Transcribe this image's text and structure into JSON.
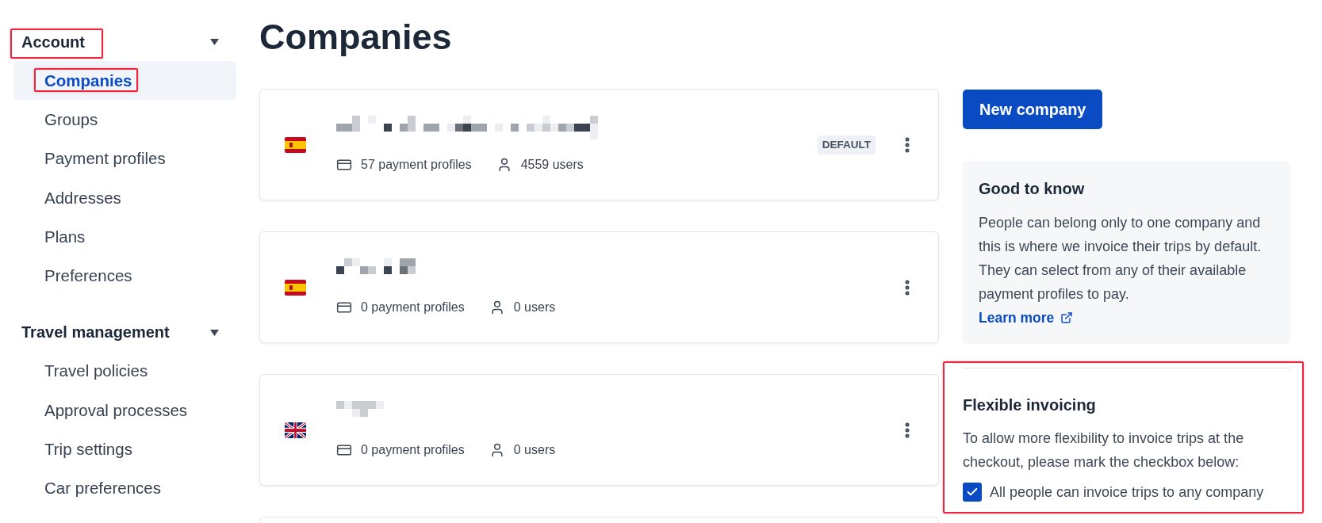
{
  "sidebar": {
    "groups": [
      {
        "title": "Account",
        "expanded": true,
        "highlighted": true,
        "items": [
          {
            "label": "Companies",
            "selected": true,
            "highlighted": true
          },
          {
            "label": "Groups",
            "selected": false,
            "highlighted": false
          },
          {
            "label": "Payment profiles",
            "selected": false,
            "highlighted": false
          },
          {
            "label": "Addresses",
            "selected": false,
            "highlighted": false
          },
          {
            "label": "Plans",
            "selected": false,
            "highlighted": false
          },
          {
            "label": "Preferences",
            "selected": false,
            "highlighted": false
          }
        ]
      },
      {
        "title": "Travel management",
        "expanded": true,
        "highlighted": false,
        "items": [
          {
            "label": "Travel policies",
            "selected": false,
            "highlighted": false
          },
          {
            "label": "Approval processes",
            "selected": false,
            "highlighted": false
          },
          {
            "label": "Trip settings",
            "selected": false,
            "highlighted": false
          },
          {
            "label": "Car preferences",
            "selected": false,
            "highlighted": false
          }
        ]
      }
    ]
  },
  "page": {
    "title": "Companies"
  },
  "companies": {
    "items": [
      {
        "kind": "spain",
        "name_pixelated": true,
        "payment_profiles": "57 payment profiles",
        "users": "4559 users",
        "badge": "DEFAULT"
      },
      {
        "kind": "spain",
        "name_pixelated": true,
        "payment_profiles": "0 payment profiles",
        "users": "0 users"
      },
      {
        "kind": "uk",
        "name_pixelated": true,
        "payment_profiles": "0 payment profiles",
        "users": "0 users"
      }
    ],
    "more_below": true
  },
  "actions": {
    "new_company_button": "New company"
  },
  "good_to_know": {
    "title": "Good to know",
    "text": "People can belong only to one company and this is where we invoice their trips by default. They can select from any of their available payment profiles to pay.",
    "link": "Learn more"
  },
  "flexible_invoicing": {
    "highlighted": true,
    "title": "Flexible invoicing",
    "text": "To allow more flexibility to invoice trips at the checkout, please mark the checkbox below:",
    "checkbox": {
      "label": "All people can invoice trips to any company",
      "checked": true
    }
  }
}
